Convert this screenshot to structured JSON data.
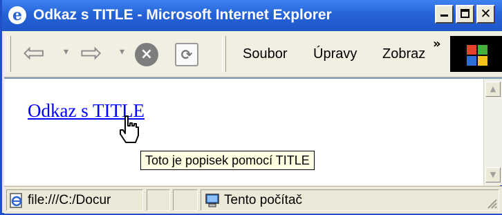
{
  "window": {
    "title": "Odkaz s TITLE - Microsoft Internet Explorer",
    "app_icon": "ie-icon",
    "controls": [
      "minimize",
      "maximize",
      "close"
    ]
  },
  "toolbar": {
    "icons": [
      "back-arrow-icon",
      "forward-arrow-icon",
      "stop-icon",
      "refresh-icon"
    ],
    "menu": [
      "Soubor",
      "Úpravy",
      "Zobraz"
    ],
    "overflow_label": "»"
  },
  "page": {
    "link_text": "Odkaz s TITLE",
    "tooltip": "Toto je popisek pomocí TITLE"
  },
  "status": {
    "url_text": "file:///C:/Docur",
    "zone_text": "Tento počítač"
  },
  "colors": {
    "titlebar": "#2563d8",
    "link": "#0000ff",
    "tooltip_bg": "#ffffe1",
    "chrome": "#ece9d8"
  }
}
